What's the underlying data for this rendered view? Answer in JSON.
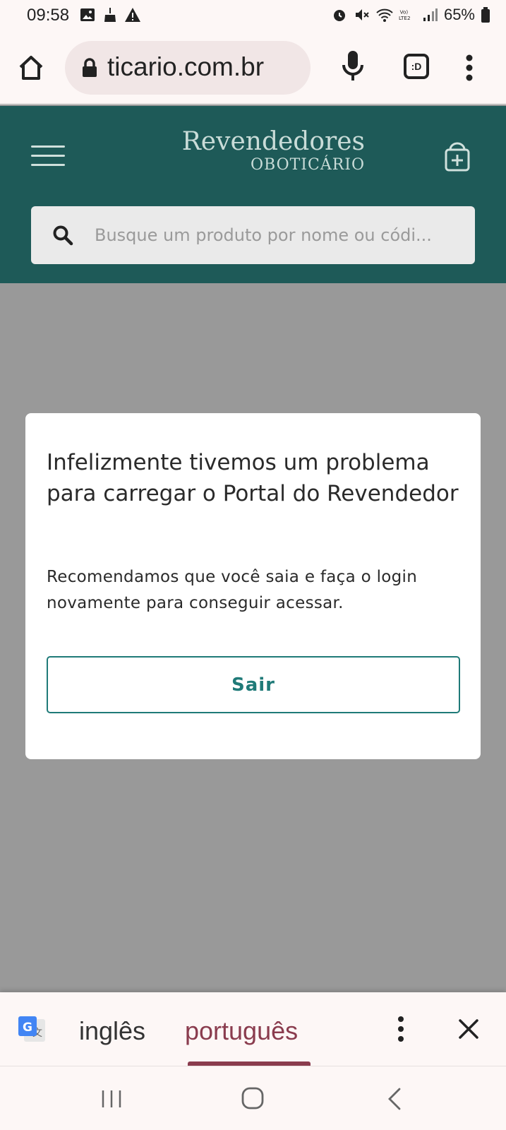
{
  "status_bar": {
    "time": "09:58",
    "battery": "65%",
    "left_icons": [
      "image-icon",
      "cleaner-icon",
      "warning-icon"
    ],
    "right_icons": [
      "alarm-icon",
      "mute-icon",
      "wifi-icon",
      "volte-icon",
      "signal-icon",
      "battery-icon"
    ]
  },
  "browser": {
    "url": "ticario.com.br",
    "tab_label": ":D",
    "icons": [
      "home-icon",
      "lock-icon",
      "mic-icon",
      "tabs-icon",
      "more-vert-icon"
    ]
  },
  "header": {
    "brand_title": "Revendedores",
    "brand_subtitle": "OBOTICÁRIO",
    "search_placeholder": "Busque um produto por nome ou códi...",
    "colors": {
      "header_bg": "#1e5a58",
      "brand_text": "#c9dcd8"
    }
  },
  "modal": {
    "title": "Infelizmente tivemos um problema para carregar o Portal do Revendedor",
    "message": "Recomendamos que você saia e faça o login novamente para conseguir acessar.",
    "button_label": "Sair",
    "colors": {
      "accent": "#1f7a78"
    }
  },
  "translate_bar": {
    "source_language": "inglês",
    "target_language": "português",
    "selected": "português",
    "colors": {
      "selected": "#8a3c4e"
    }
  },
  "nav_bar": {
    "buttons": [
      "recents-icon",
      "home-nav-icon",
      "back-icon"
    ]
  }
}
